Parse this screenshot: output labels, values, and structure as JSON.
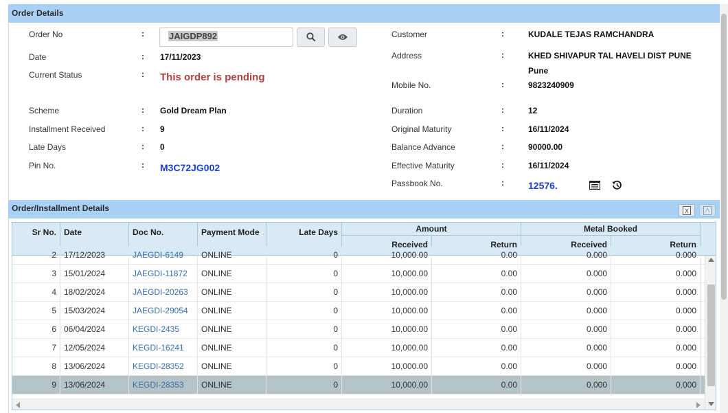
{
  "order_details": {
    "header": "Order Details",
    "order_no_label": "Order No",
    "order_no_value": "JAIGDP892",
    "date_label": "Date",
    "date_value": "17/11/2023",
    "status_label": "Current Status",
    "status_value": "This order is pending",
    "scheme_label": "Scheme",
    "scheme_value": "Gold Dream Plan",
    "inst_label": "Installment Received",
    "inst_value": "9",
    "late_label": "Late Days",
    "late_value": "0",
    "pin_label": "Pin No.",
    "pin_value": "M3C72JG002",
    "customer_label": "Customer",
    "customer_value": "KUDALE TEJAS RAMCHANDRA",
    "address_label": "Address",
    "address_line1": "KHED SHIVAPUR TAL HAVELI DIST PUNE",
    "address_line2": "Pune",
    "mobile_label": "Mobile No.",
    "mobile_value": "9823240909",
    "duration_label": "Duration",
    "duration_value": "12",
    "orig_maturity_label": "Original Maturity",
    "orig_maturity_value": "16/11/2024",
    "balance_label": "Balance Advance",
    "balance_value": "90000.00",
    "eff_maturity_label": "Effective Maturity",
    "eff_maturity_value": "16/11/2024",
    "passbook_label": "Passbook No.",
    "passbook_value": "12576.",
    "colon": ":"
  },
  "installments": {
    "header": "Order/Installment Details",
    "columns": {
      "sr": "Sr No.",
      "date": "Date",
      "doc": "Doc No.",
      "mode": "Payment Mode",
      "late": "Late Days",
      "amount": "Amount",
      "metal": "Metal Booked",
      "received": "Received",
      "return": "Return"
    },
    "rows": [
      {
        "sr": "2",
        "date": "17/12/2023",
        "doc": "JAEGDI-6149",
        "mode": "ONLINE",
        "late": "0",
        "amt_rec": "10,000.00",
        "amt_ret": "0.00",
        "met_rec": "0.000",
        "met_ret": "0.000"
      },
      {
        "sr": "3",
        "date": "15/01/2024",
        "doc": "JAEGDI-11872",
        "mode": "ONLINE",
        "late": "0",
        "amt_rec": "10,000.00",
        "amt_ret": "0.00",
        "met_rec": "0.000",
        "met_ret": "0.000"
      },
      {
        "sr": "4",
        "date": "18/02/2024",
        "doc": "JAEGDI-20263",
        "mode": "ONLINE",
        "late": "0",
        "amt_rec": "10,000.00",
        "amt_ret": "0.00",
        "met_rec": "0.000",
        "met_ret": "0.000"
      },
      {
        "sr": "5",
        "date": "15/03/2024",
        "doc": "JAEGDI-29054",
        "mode": "ONLINE",
        "late": "0",
        "amt_rec": "10,000.00",
        "amt_ret": "0.00",
        "met_rec": "0.000",
        "met_ret": "0.000"
      },
      {
        "sr": "6",
        "date": "06/04/2024",
        "doc": "KEGDI-2435",
        "mode": "ONLINE",
        "late": "0",
        "amt_rec": "10,000.00",
        "amt_ret": "0.00",
        "met_rec": "0.000",
        "met_ret": "0.000"
      },
      {
        "sr": "7",
        "date": "12/05/2024",
        "doc": "KEGDI-16241",
        "mode": "ONLINE",
        "late": "0",
        "amt_rec": "10,000.00",
        "amt_ret": "0.00",
        "met_rec": "0.000",
        "met_ret": "0.000"
      },
      {
        "sr": "8",
        "date": "13/06/2024",
        "doc": "KEGDI-28352",
        "mode": "ONLINE",
        "late": "0",
        "amt_rec": "10,000.00",
        "amt_ret": "0.00",
        "met_rec": "0.000",
        "met_ret": "0.000"
      },
      {
        "sr": "9",
        "date": "13/06/2024",
        "doc": "KEGDI-28353",
        "mode": "ONLINE",
        "late": "0",
        "amt_rec": "10,000.00",
        "amt_ret": "0.00",
        "met_rec": "0.000",
        "met_ret": "0.000"
      }
    ]
  },
  "colors": {
    "header_bg": "#a9d0f5",
    "pending": "#b04040",
    "link_blue": "#1a3fd6",
    "selected_row": "#b3c3c6"
  }
}
